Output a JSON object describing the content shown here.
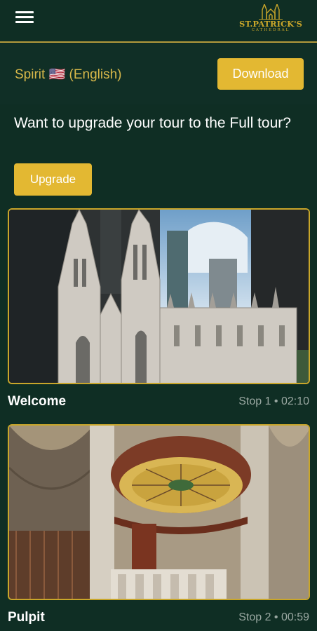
{
  "header": {
    "menu_icon": "hamburger-menu-icon",
    "logo_name": "ST.PATRICK'S",
    "logo_sub": "CATHEDRAL",
    "brand_color": "#c9a62a"
  },
  "language": {
    "label": "Spirit 🇺🇸 (English)",
    "download_label": "Download"
  },
  "upgrade": {
    "prompt": "Want to upgrade your tour to the Full tour?",
    "button_label": "Upgrade"
  },
  "stops": [
    {
      "title": "Welcome",
      "meta": "Stop 1 • 02:10"
    },
    {
      "title": "Pulpit",
      "meta": "Stop 2 • 00:59"
    }
  ],
  "colors": {
    "background": "#0f2e24",
    "accent": "#e3b832",
    "gold": "#c9a62a"
  }
}
